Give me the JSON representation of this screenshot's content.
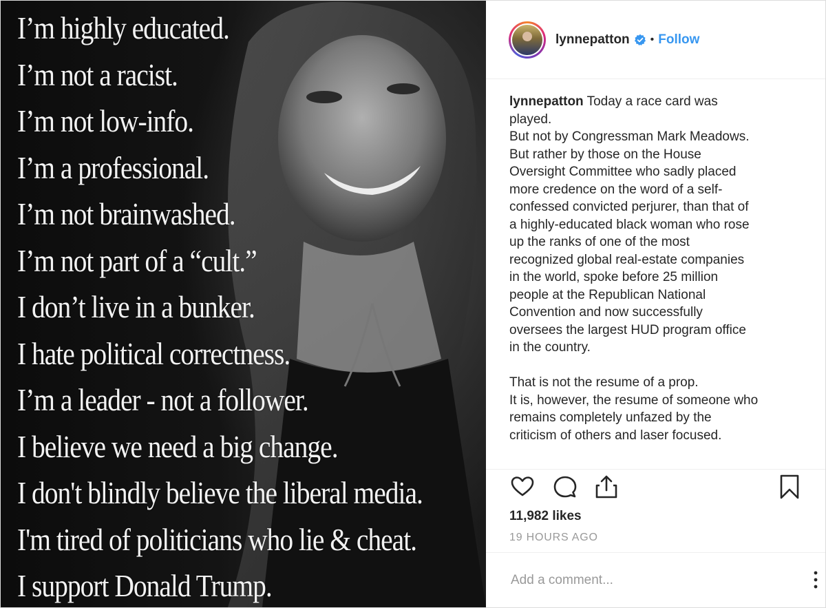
{
  "image": {
    "lines": [
      "I’m highly educated.",
      "I’m not a racist.",
      "I’m not low-info.",
      "I’m a professional.",
      "I’m not brainwashed.",
      "I’m not part of a “cult.”",
      "I don’t live in a bunker.",
      "I hate political correctness.",
      "I’m a leader - not a follower.",
      "I believe we need a big change.",
      "I don't blindly believe the liberal media.",
      "I'm tired of politicians who lie & cheat.",
      "I support Donald Trump."
    ]
  },
  "header": {
    "username": "lynnepatton",
    "separator": "•",
    "follow_label": "Follow",
    "accent_color": "#3897f0"
  },
  "caption": {
    "username": "lynnepatton",
    "lines": [
      "Today a race card was",
      "played.",
      "But not by Congressman Mark Meadows.",
      "But rather by those on the House",
      "Oversight Committee who sadly placed",
      "more credence on the word of a self-",
      "confessed convicted perjurer, than that of",
      "a highly-educated black woman who rose",
      "up the ranks of one of the most",
      "recognized global real-estate companies",
      "in the world, spoke before 25 million",
      "people at the Republican National",
      "Convention and now successfully",
      "oversees the largest HUD program office",
      "in the country.",
      "",
      "That is not the resume of a prop.",
      "It is, however, the resume of someone who",
      "remains completely unfazed by the",
      "criticism of others and laser focused."
    ]
  },
  "actions": {
    "icons": [
      "heart-icon",
      "comment-icon",
      "share-icon",
      "bookmark-icon"
    ],
    "likes": "11,982 likes",
    "timestamp": "19 HOURS AGO"
  },
  "comment": {
    "placeholder": "Add a comment..."
  }
}
